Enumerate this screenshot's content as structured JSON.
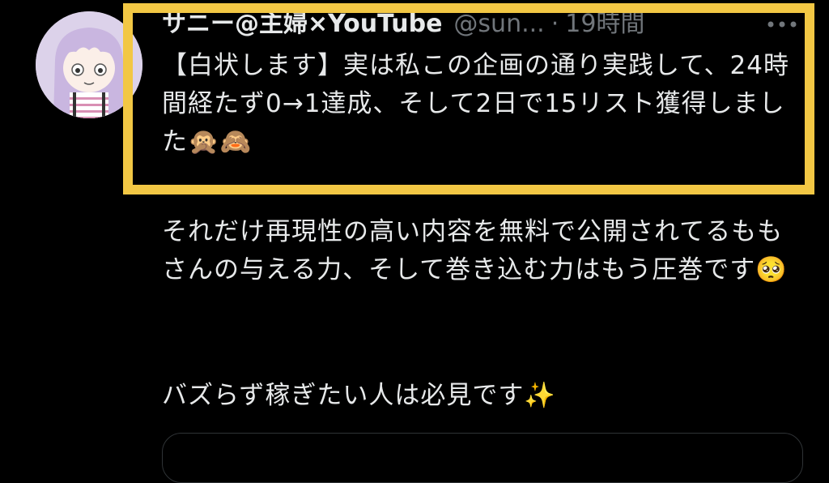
{
  "tweet": {
    "author": {
      "display_name": "サニー@主婦×YouTube",
      "handle": "@sun...",
      "separator": "·",
      "time": "19時間"
    },
    "paragraphs": [
      "【白状します】実は私この企画の通り実践して、24時間経たず0→1達成、そして2日で15リスト獲得しました🙊🙈",
      "それだけ再現性の高い内容を無料で公開されてるももさんの与える力、そして巻き込む力はもう圧巻です🥺",
      "バズらず稼ぎたい人は必見です✨"
    ]
  },
  "icons": {
    "more": "more-horizontal-icon",
    "avatar": "avatar-illustration"
  },
  "colors": {
    "background": "#000000",
    "text": "#e7e9ea",
    "muted": "#71767b",
    "highlight_border": "#f2c744"
  }
}
